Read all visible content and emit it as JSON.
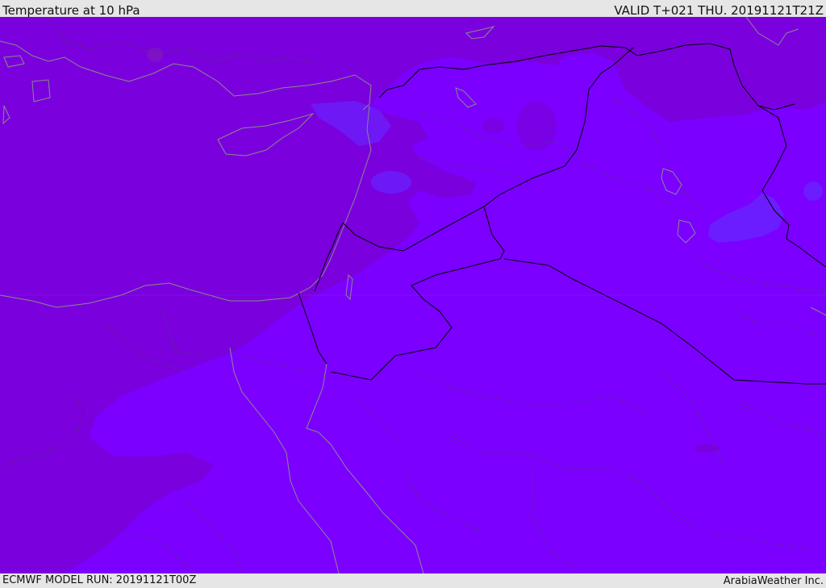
{
  "header": {
    "title": "Temperature at 10 hPa",
    "valid": "VALID T+021 THU. 20191121T21Z"
  },
  "footer": {
    "model_run": "ECMWF MODEL RUN: 20191121T00Z",
    "credit": "ArabiaWeather Inc."
  },
  "map": {
    "field": "temperature",
    "level": "10 hPa",
    "colors": {
      "background_field": "#7b00ff",
      "warm_field": "#7a00dd",
      "warmer_patch": "#7f0fc8",
      "cool_patch": "#6a22ff",
      "coastline": "#8a8a8a",
      "political_border": "#000000",
      "internal_border": "#4a4a4a"
    }
  }
}
